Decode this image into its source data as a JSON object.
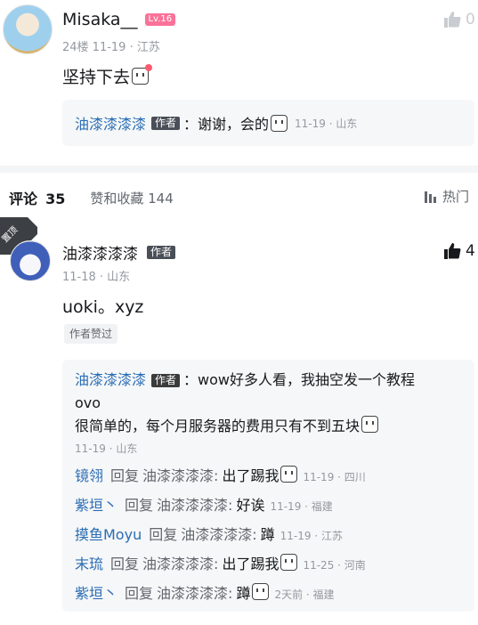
{
  "comment1": {
    "username": "Misaka__",
    "level": "Lv.16",
    "floor_meta": "24楼 11-19 · 江苏",
    "content": "坚持下去",
    "like_count": "0",
    "reply": {
      "username": "油漆漆漆漆",
      "author_tag": "作者",
      "text": "：谢谢，会的",
      "meta": "11-19 · 山东"
    }
  },
  "tabs": {
    "comments_label": "评论",
    "comments_count": "35",
    "likes_label": "赞和收藏 144",
    "sort_label": "热门"
  },
  "pinned_comment": {
    "pin_label": "置顶",
    "username": "油漆漆漆漆",
    "author_tag": "作者",
    "meta": "11-18 · 山东",
    "content": "uoki。xyz",
    "author_liked": "作者赞过",
    "like_count": "4",
    "replies_head": {
      "username": "油漆漆漆漆",
      "author_tag": "作者",
      "line1": "：wow好多人看，我抽空发一个教程",
      "line2": "ovo",
      "line3": "很简单的，每个月服务器的费用只有不到五块",
      "meta": "11-19 · 山东"
    },
    "replies": [
      {
        "username": "镜翎",
        "reply_word": "回复",
        "target": "油漆漆漆漆:",
        "text": "出了踢我",
        "emoji": true,
        "meta": "11-19 · 四川"
      },
      {
        "username": "紫垣丶",
        "reply_word": "回复",
        "target": "油漆漆漆漆:",
        "text": "好诶",
        "emoji": false,
        "meta": "11-19 · 福建"
      },
      {
        "username": "摸鱼Moyu",
        "reply_word": "回复",
        "target": "油漆漆漆漆:",
        "text": "蹲",
        "emoji": false,
        "meta": "11-19 · 江苏"
      },
      {
        "username": "末琉",
        "reply_word": "回复",
        "target": "油漆漆漆漆:",
        "text": "出了踢我",
        "emoji": true,
        "meta": "11-25 · 河南"
      },
      {
        "username": "紫垣丶",
        "reply_word": "回复",
        "target": "油漆漆漆漆:",
        "text": "蹲",
        "emoji": true,
        "meta": "2天前 · 福建"
      }
    ]
  },
  "colors": {
    "link_blue": "#2a6db4",
    "level_badge": "#fb7299",
    "gray_text": "#9499a0"
  }
}
